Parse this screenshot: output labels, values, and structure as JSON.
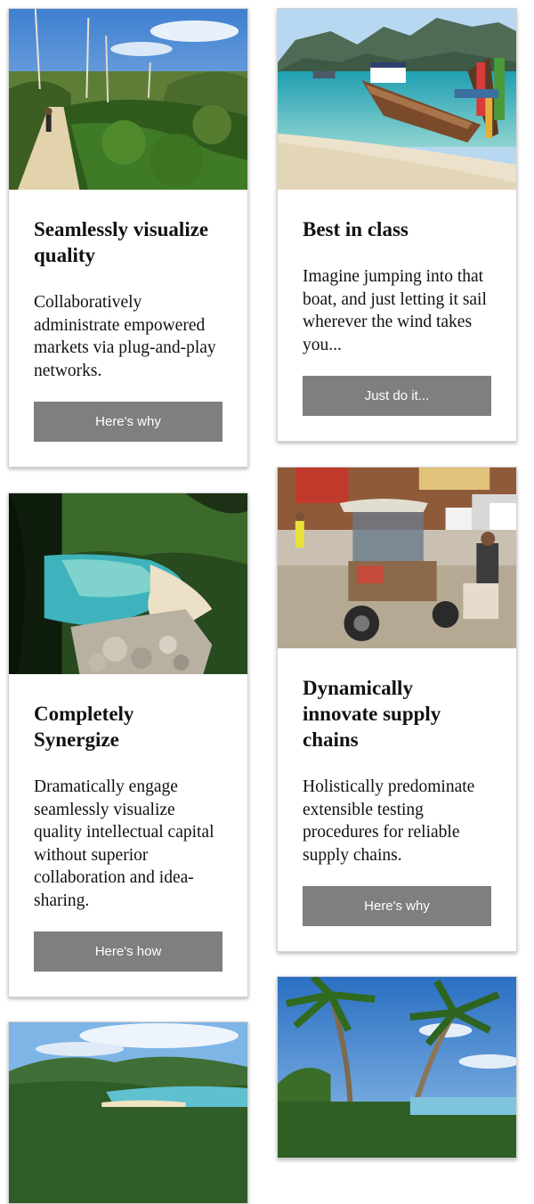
{
  "cards": [
    {
      "image": "forest-trail-photo",
      "title": "Seamlessly visualize quality",
      "text": "Collaboratively administrate empowered markets via plug-and-play networks.",
      "button": "Here's why"
    },
    {
      "image": "longtail-boat-beach-photo",
      "title": "Best in class",
      "text": "Imagine jumping into that boat, and just letting it sail wherever the wind takes you...",
      "button": "Just do it..."
    },
    {
      "image": "rocky-cove-beach-photo",
      "title": "Completely Synergize",
      "text": "Dramatically engage seamlessly visualize quality intellectual capital without superior collaboration and idea-sharing.",
      "button": "Here's how"
    },
    {
      "image": "tuk-tuk-street-photo",
      "title": "Dynamically innovate supply chains",
      "text": "Holistically predominate extensible testing procedures for reliable supply chains.",
      "button": "Here's why"
    },
    {
      "image": "bay-hills-photo"
    },
    {
      "image": "palm-trees-beach-photo"
    }
  ]
}
